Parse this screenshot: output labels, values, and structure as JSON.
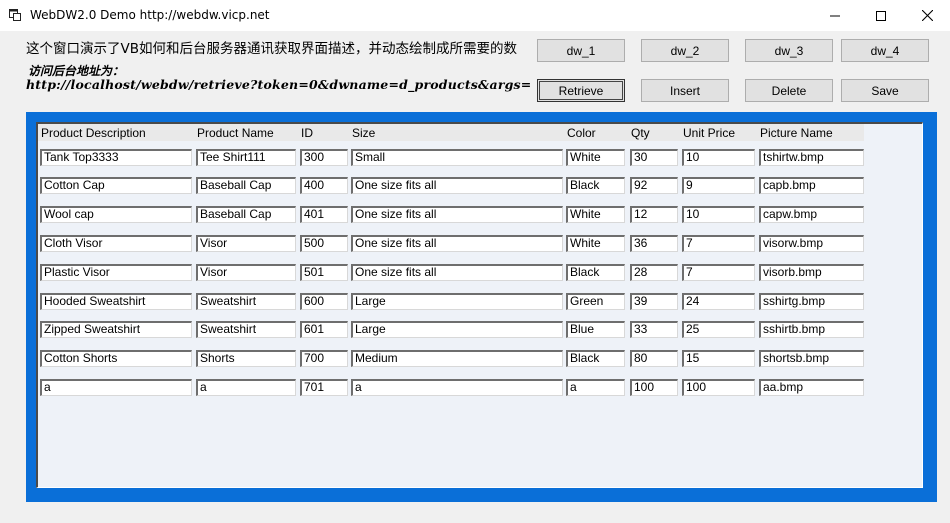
{
  "window": {
    "title": "WebDW2.0 Demo http://webdw.vicp.net"
  },
  "header": {
    "description": "这个窗口演示了VB如何和后台服务器通讯获取界面描述，并动态绘制成所需要的数",
    "url_label": "访问后台地址为：",
    "url_value": "http://localhost/webdw/retrieve?token=0&dwname=d_products&args="
  },
  "buttons": {
    "dw_1": "dw_1",
    "dw_2": "dw_2",
    "dw_3": "dw_3",
    "dw_4": "dw_4",
    "retrieve": "Retrieve",
    "insert": "Insert",
    "delete": "Delete",
    "save": "Save"
  },
  "grid": {
    "columns": [
      "Product Description",
      "Product Name",
      "ID",
      "Size",
      "Color",
      "Qty",
      "Unit Price",
      "Picture Name"
    ],
    "rows": [
      [
        "Tank Top3333",
        "Tee Shirt111",
        "300",
        "Small",
        "White",
        "30",
        "10",
        "tshirtw.bmp"
      ],
      [
        "Cotton Cap",
        "Baseball Cap",
        "400",
        "One size fits all",
        "Black",
        "92",
        "9",
        "capb.bmp"
      ],
      [
        "Wool cap",
        "Baseball Cap",
        "401",
        "One size fits all",
        "White",
        "12",
        "10",
        "capw.bmp"
      ],
      [
        "Cloth Visor",
        "Visor",
        "500",
        "One size fits all",
        "White",
        "36",
        "7",
        "visorw.bmp"
      ],
      [
        "Plastic Visor",
        "Visor",
        "501",
        "One size fits all",
        "Black",
        "28",
        "7",
        "visorb.bmp"
      ],
      [
        "Hooded Sweatshirt",
        "Sweatshirt",
        "600",
        "Large",
        "Green",
        "39",
        "24",
        "sshirtg.bmp"
      ],
      [
        "Zipped Sweatshirt",
        "Sweatshirt",
        "601",
        "Large",
        "Blue",
        "33",
        "25",
        "sshirtb.bmp"
      ],
      [
        "Cotton Shorts",
        "Shorts",
        "700",
        "Medium",
        "Black",
        "80",
        "15",
        "shortsb.bmp"
      ],
      [
        "a",
        "a",
        "701",
        "a",
        "a",
        "100",
        "100",
        "aa.bmp"
      ]
    ]
  },
  "colors": {
    "panel_border": "#0a6fd8",
    "panel_bg": "#eef2f8"
  }
}
